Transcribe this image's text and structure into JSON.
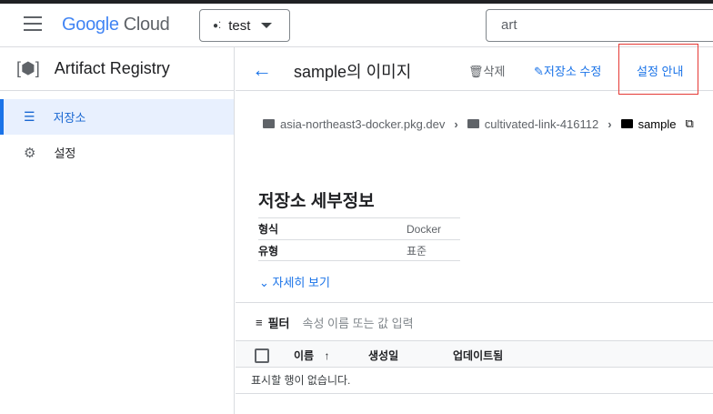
{
  "header": {
    "logo_google": "Google",
    "logo_cloud": "Cloud",
    "project": "test",
    "search_value": "art"
  },
  "sidebar": {
    "product": "Artifact Registry",
    "items": [
      {
        "label": "저장소"
      },
      {
        "label": "설정"
      }
    ]
  },
  "toolbar": {
    "title": "sample의 이미지",
    "delete": "삭제",
    "edit": "저장소 수정",
    "setup": "설정 안내"
  },
  "breadcrumb": [
    "asia-northeast3-docker.pkg.dev",
    "cultivated-link-416112",
    "sample"
  ],
  "details": {
    "heading": "저장소 세부정보",
    "rows": [
      {
        "key": "형식",
        "value": "Docker"
      },
      {
        "key": "유형",
        "value": "표준"
      }
    ],
    "more": "자세히 보기"
  },
  "filter": {
    "label": "필터",
    "placeholder": "속성 이름 또는 값 입력"
  },
  "table": {
    "columns": [
      "이름",
      "생성일",
      "업데이트됨"
    ],
    "empty": "표시할 행이 없습니다."
  }
}
